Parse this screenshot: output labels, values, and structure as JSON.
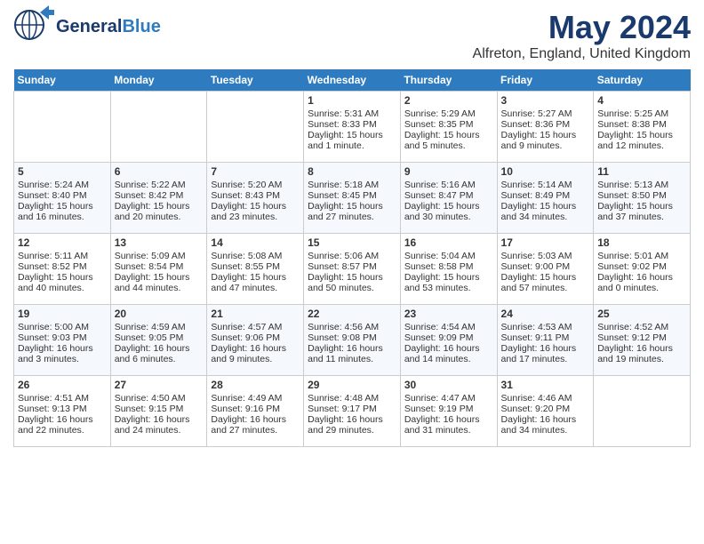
{
  "header": {
    "logo_general": "General",
    "logo_blue": "Blue",
    "month": "May 2024",
    "location": "Alfreton, England, United Kingdom"
  },
  "weekdays": [
    "Sunday",
    "Monday",
    "Tuesday",
    "Wednesday",
    "Thursday",
    "Friday",
    "Saturday"
  ],
  "weeks": [
    [
      {
        "day": "",
        "text": ""
      },
      {
        "day": "",
        "text": ""
      },
      {
        "day": "",
        "text": ""
      },
      {
        "day": "1",
        "text": "Sunrise: 5:31 AM\nSunset: 8:33 PM\nDaylight: 15 hours\nand 1 minute."
      },
      {
        "day": "2",
        "text": "Sunrise: 5:29 AM\nSunset: 8:35 PM\nDaylight: 15 hours\nand 5 minutes."
      },
      {
        "day": "3",
        "text": "Sunrise: 5:27 AM\nSunset: 8:36 PM\nDaylight: 15 hours\nand 9 minutes."
      },
      {
        "day": "4",
        "text": "Sunrise: 5:25 AM\nSunset: 8:38 PM\nDaylight: 15 hours\nand 12 minutes."
      }
    ],
    [
      {
        "day": "5",
        "text": "Sunrise: 5:24 AM\nSunset: 8:40 PM\nDaylight: 15 hours\nand 16 minutes."
      },
      {
        "day": "6",
        "text": "Sunrise: 5:22 AM\nSunset: 8:42 PM\nDaylight: 15 hours\nand 20 minutes."
      },
      {
        "day": "7",
        "text": "Sunrise: 5:20 AM\nSunset: 8:43 PM\nDaylight: 15 hours\nand 23 minutes."
      },
      {
        "day": "8",
        "text": "Sunrise: 5:18 AM\nSunset: 8:45 PM\nDaylight: 15 hours\nand 27 minutes."
      },
      {
        "day": "9",
        "text": "Sunrise: 5:16 AM\nSunset: 8:47 PM\nDaylight: 15 hours\nand 30 minutes."
      },
      {
        "day": "10",
        "text": "Sunrise: 5:14 AM\nSunset: 8:49 PM\nDaylight: 15 hours\nand 34 minutes."
      },
      {
        "day": "11",
        "text": "Sunrise: 5:13 AM\nSunset: 8:50 PM\nDaylight: 15 hours\nand 37 minutes."
      }
    ],
    [
      {
        "day": "12",
        "text": "Sunrise: 5:11 AM\nSunset: 8:52 PM\nDaylight: 15 hours\nand 40 minutes."
      },
      {
        "day": "13",
        "text": "Sunrise: 5:09 AM\nSunset: 8:54 PM\nDaylight: 15 hours\nand 44 minutes."
      },
      {
        "day": "14",
        "text": "Sunrise: 5:08 AM\nSunset: 8:55 PM\nDaylight: 15 hours\nand 47 minutes."
      },
      {
        "day": "15",
        "text": "Sunrise: 5:06 AM\nSunset: 8:57 PM\nDaylight: 15 hours\nand 50 minutes."
      },
      {
        "day": "16",
        "text": "Sunrise: 5:04 AM\nSunset: 8:58 PM\nDaylight: 15 hours\nand 53 minutes."
      },
      {
        "day": "17",
        "text": "Sunrise: 5:03 AM\nSunset: 9:00 PM\nDaylight: 15 hours\nand 57 minutes."
      },
      {
        "day": "18",
        "text": "Sunrise: 5:01 AM\nSunset: 9:02 PM\nDaylight: 16 hours\nand 0 minutes."
      }
    ],
    [
      {
        "day": "19",
        "text": "Sunrise: 5:00 AM\nSunset: 9:03 PM\nDaylight: 16 hours\nand 3 minutes."
      },
      {
        "day": "20",
        "text": "Sunrise: 4:59 AM\nSunset: 9:05 PM\nDaylight: 16 hours\nand 6 minutes."
      },
      {
        "day": "21",
        "text": "Sunrise: 4:57 AM\nSunset: 9:06 PM\nDaylight: 16 hours\nand 9 minutes."
      },
      {
        "day": "22",
        "text": "Sunrise: 4:56 AM\nSunset: 9:08 PM\nDaylight: 16 hours\nand 11 minutes."
      },
      {
        "day": "23",
        "text": "Sunrise: 4:54 AM\nSunset: 9:09 PM\nDaylight: 16 hours\nand 14 minutes."
      },
      {
        "day": "24",
        "text": "Sunrise: 4:53 AM\nSunset: 9:11 PM\nDaylight: 16 hours\nand 17 minutes."
      },
      {
        "day": "25",
        "text": "Sunrise: 4:52 AM\nSunset: 9:12 PM\nDaylight: 16 hours\nand 19 minutes."
      }
    ],
    [
      {
        "day": "26",
        "text": "Sunrise: 4:51 AM\nSunset: 9:13 PM\nDaylight: 16 hours\nand 22 minutes."
      },
      {
        "day": "27",
        "text": "Sunrise: 4:50 AM\nSunset: 9:15 PM\nDaylight: 16 hours\nand 24 minutes."
      },
      {
        "day": "28",
        "text": "Sunrise: 4:49 AM\nSunset: 9:16 PM\nDaylight: 16 hours\nand 27 minutes."
      },
      {
        "day": "29",
        "text": "Sunrise: 4:48 AM\nSunset: 9:17 PM\nDaylight: 16 hours\nand 29 minutes."
      },
      {
        "day": "30",
        "text": "Sunrise: 4:47 AM\nSunset: 9:19 PM\nDaylight: 16 hours\nand 31 minutes."
      },
      {
        "day": "31",
        "text": "Sunrise: 4:46 AM\nSunset: 9:20 PM\nDaylight: 16 hours\nand 34 minutes."
      },
      {
        "day": "",
        "text": ""
      }
    ]
  ]
}
